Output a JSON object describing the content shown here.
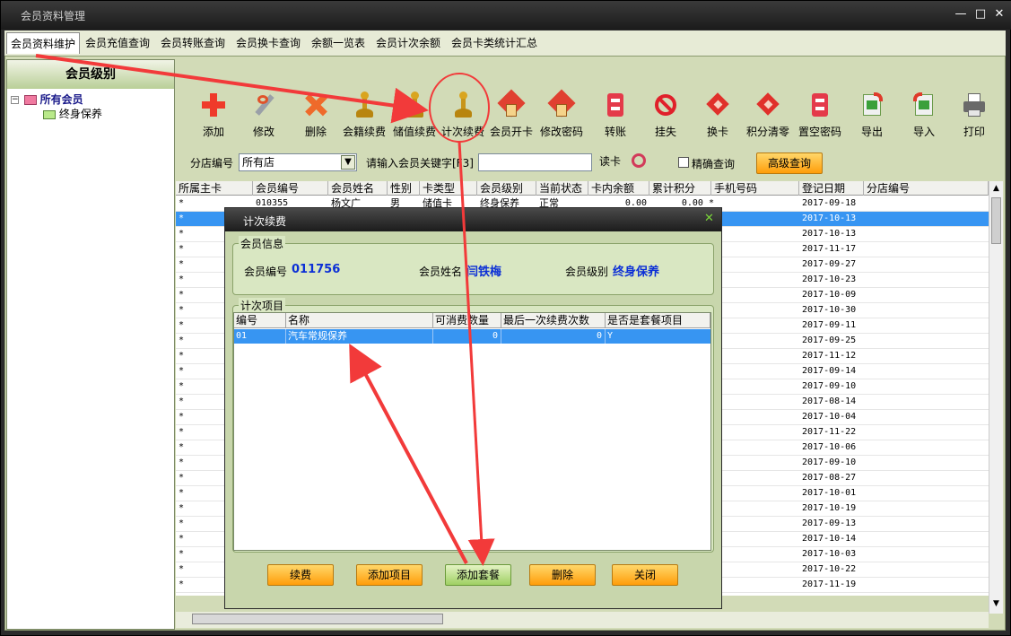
{
  "window": {
    "title": "会员资料管理",
    "min": "—",
    "max": "□",
    "close": "✕"
  },
  "tabs": [
    "会员资料维护",
    "会员充值查询",
    "会员转账查询",
    "会员换卡查询",
    "余额一览表",
    "会员计次余额",
    "会员卡类统计汇总"
  ],
  "sidebar": {
    "header": "会员级别",
    "root": "所有会员",
    "child": "终身保养"
  },
  "toolbar": [
    {
      "label": "添加",
      "icon": "plus-icon"
    },
    {
      "label": "修改",
      "icon": "wrench-icon"
    },
    {
      "label": "删除",
      "icon": "delete-icon"
    },
    {
      "label": "会籍续费",
      "icon": "pawn-icon"
    },
    {
      "label": "储值续费",
      "icon": "pawn-icon"
    },
    {
      "label": "计次续费",
      "icon": "pawn-icon"
    },
    {
      "label": "会员开卡",
      "icon": "house-icon"
    },
    {
      "label": "修改密码",
      "icon": "house-icon"
    },
    {
      "label": "转账",
      "icon": "transfer-icon"
    },
    {
      "label": "挂失",
      "icon": "ban-icon"
    },
    {
      "label": "换卡",
      "icon": "diamond-icon"
    },
    {
      "label": "积分清零",
      "icon": "diamond-icon"
    },
    {
      "label": "置空密码",
      "icon": "transfer-icon"
    },
    {
      "label": "导出",
      "icon": "export-icon"
    },
    {
      "label": "导入",
      "icon": "import-icon"
    },
    {
      "label": "打印",
      "icon": "printer-icon"
    }
  ],
  "filter": {
    "branch_label": "分店编号",
    "branch_value": "所有店",
    "keyword_label": "请输入会员关键字[F3]",
    "keyword_value": "",
    "read_card": "读卡",
    "exact_label": "精确查询",
    "advanced": "高级查询"
  },
  "grid": {
    "columns": [
      "所属主卡",
      "会员编号",
      "会员姓名",
      "性别",
      "卡类型",
      "会员级别",
      "当前状态",
      "卡内余额",
      "累计积分",
      "手机号码",
      "登记日期",
      "分店编号"
    ],
    "first_row": {
      "main": "*",
      "id": "010355",
      "name": "杨文广",
      "sex": "男",
      "type": "储值卡",
      "level": "终身保养",
      "status": "正常",
      "balance": "0.00",
      "points": "0.00 *",
      "date": "2017-09-18"
    },
    "rows": [
      {
        "main": "*",
        "date": "2017-10-13"
      },
      {
        "main": "*",
        "date": "2017-10-13"
      },
      {
        "main": "*",
        "date": "2017-11-17"
      },
      {
        "main": "*",
        "date": "2017-09-27"
      },
      {
        "main": "*",
        "date": "2017-10-23"
      },
      {
        "main": "*",
        "date": "2017-10-09"
      },
      {
        "main": "*",
        "date": "2017-10-30"
      },
      {
        "main": "*",
        "date": "2017-09-11"
      },
      {
        "main": "*",
        "date": "2017-09-25"
      },
      {
        "main": "*",
        "date": "2017-11-12"
      },
      {
        "main": "*",
        "date": "2017-09-14"
      },
      {
        "main": "*",
        "date": "2017-09-10"
      },
      {
        "main": "*",
        "date": "2017-08-14"
      },
      {
        "main": "*",
        "date": "2017-10-04"
      },
      {
        "main": "*",
        "date": "2017-11-22"
      },
      {
        "main": "*",
        "date": "2017-10-06"
      },
      {
        "main": "*",
        "date": "2017-09-10"
      },
      {
        "main": "*",
        "date": "2017-08-27"
      },
      {
        "main": "*",
        "date": "2017-10-01"
      },
      {
        "main": "*",
        "date": "2017-10-19"
      },
      {
        "main": "*",
        "date": "2017-09-13"
      },
      {
        "main": "*",
        "date": "2017-10-14"
      },
      {
        "main": "*",
        "date": "2017-10-03"
      },
      {
        "main": "*",
        "date": "2017-10-22"
      },
      {
        "main": "*",
        "date": "2017-11-19"
      }
    ]
  },
  "dialog": {
    "title": "计次续费",
    "close": "✕",
    "info_group": "会员信息",
    "member_id_label": "会员编号",
    "member_id": "011756",
    "member_name_label": "会员姓名",
    "member_name": "闫铁梅",
    "member_level_label": "会员级别",
    "member_level": "终身保养",
    "items_group": "计次项目",
    "item_columns": [
      "编号",
      "名称",
      "可消费数量",
      "最后一次续费次数",
      "是否是套餐项目"
    ],
    "item_row": {
      "code": "01",
      "name": "汽车常规保养",
      "qty": "0",
      "last": "0",
      "package": "Y"
    },
    "buttons": [
      "续费",
      "添加项目",
      "添加套餐",
      "删除",
      "关闭"
    ]
  },
  "colors": {
    "accent_orange": "#ff9d0a",
    "selection_blue": "#3795f2",
    "annotation_red": "#f23a3a"
  }
}
